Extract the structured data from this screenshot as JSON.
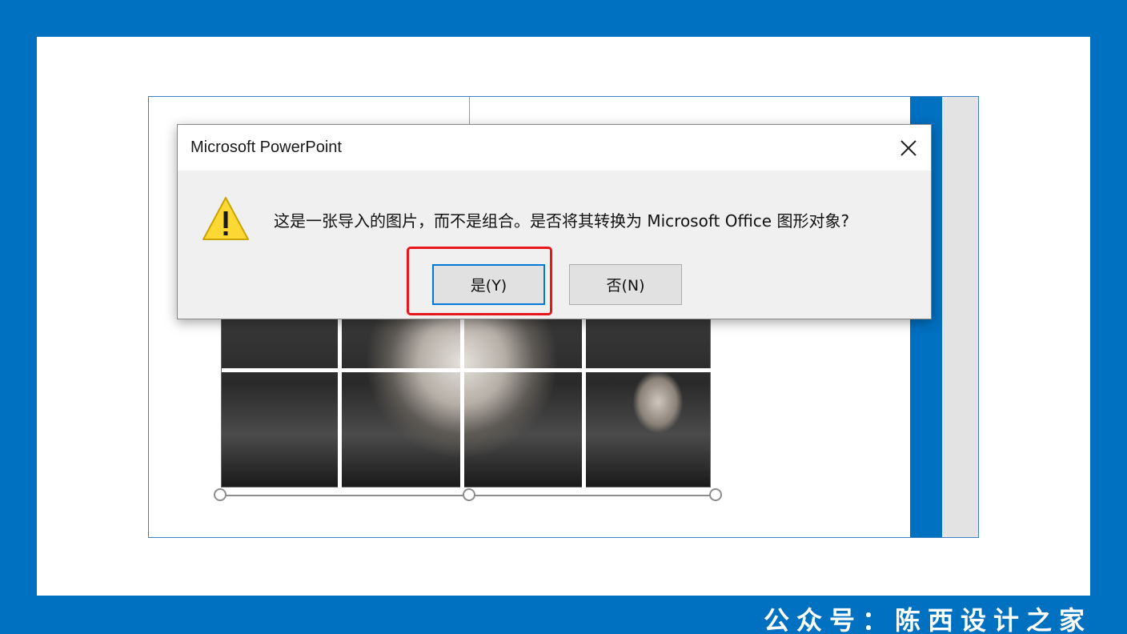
{
  "dialog": {
    "title": "Microsoft PowerPoint",
    "close_icon": "close-icon",
    "warning_icon": "warning-icon",
    "message": "这是一张导入的图片，而不是组合。是否将其转换为 Microsoft Office 图形对象?",
    "yes_label": "是(Y)",
    "no_label": "否(N)"
  },
  "footer": {
    "credit": "公众号：陈西设计之家"
  },
  "colors": {
    "background": "#0070C0",
    "highlight": "#e8151b",
    "default_button_border": "#0078d7"
  }
}
